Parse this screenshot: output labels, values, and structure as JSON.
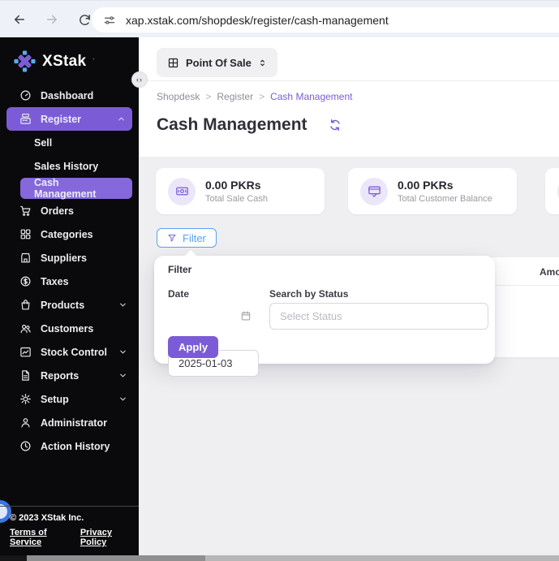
{
  "browser": {
    "url": "xap.xstak.com/shopdesk/register/cash-management"
  },
  "sidebar": {
    "logo_text": "XStak",
    "nav": [
      {
        "label": "Dashboard",
        "icon": "dashboard-icon"
      },
      {
        "label": "Register",
        "icon": "register-icon",
        "state": "expanded-active"
      },
      {
        "label": "Orders",
        "icon": "orders-icon"
      },
      {
        "label": "Categories",
        "icon": "categories-icon"
      },
      {
        "label": "Suppliers",
        "icon": "suppliers-icon"
      },
      {
        "label": "Taxes",
        "icon": "taxes-icon"
      },
      {
        "label": "Products",
        "icon": "products-icon",
        "state": "collapsed"
      },
      {
        "label": "Customers",
        "icon": "customers-icon"
      },
      {
        "label": "Stock Control",
        "icon": "stock-control-icon",
        "state": "collapsed"
      },
      {
        "label": "Reports",
        "icon": "reports-icon",
        "state": "collapsed"
      },
      {
        "label": "Setup",
        "icon": "setup-icon",
        "state": "collapsed"
      },
      {
        "label": "Administrator",
        "icon": "administrator-icon"
      },
      {
        "label": "Action History",
        "icon": "action-history-icon"
      }
    ],
    "register_submenu": [
      {
        "label": "Sell"
      },
      {
        "label": "Sales History"
      },
      {
        "label": "Cash Management",
        "active": true
      }
    ],
    "footer": {
      "copyright": "© 2023 XStak Inc.",
      "terms": "Terms of Service",
      "privacy": "Privacy Policy"
    }
  },
  "topbar": {
    "store_selector": "Point Of Sale"
  },
  "breadcrumb": {
    "items": [
      "Shopdesk",
      "Register",
      "Cash Management"
    ],
    "separator": ">"
  },
  "page": {
    "title": "Cash Management"
  },
  "stats_cards": [
    {
      "value": "0.00 PKRs",
      "label": "Total Sale Cash",
      "icon": "banknote-icon"
    },
    {
      "value": "0.00 PKRs",
      "label": "Total Customer Balance",
      "icon": "credit-card-icon"
    },
    {
      "value": "",
      "label": "",
      "icon": "cash-in-out-icon"
    }
  ],
  "filter": {
    "button_label": "Filter",
    "panel_title": "Filter",
    "date_label": "Date",
    "date_value": "2025-01-03",
    "status_label": "Search by Status",
    "status_placeholder": "Select Status",
    "apply_label": "Apply"
  },
  "table": {
    "headers": [
      "Amount"
    ]
  },
  "colors": {
    "accent_purple": "#7b5cd6",
    "accent_purple_light": "#8468dc",
    "link_blue": "#5aa2f2",
    "sidebar_bg": "#0a0a0c"
  }
}
